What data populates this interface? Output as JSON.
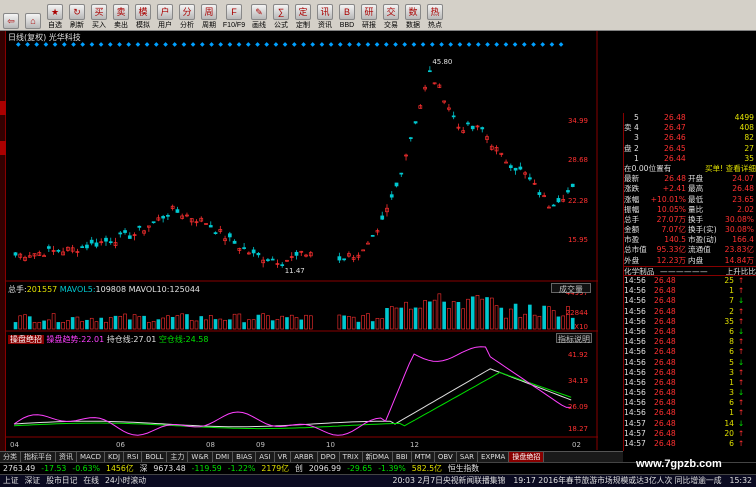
{
  "toolbar": {
    "buttons": [
      {
        "name": "back",
        "label": ""
      },
      {
        "name": "home",
        "label": ""
      },
      {
        "name": "zixuan",
        "label": "自选"
      },
      {
        "name": "shuaxin",
        "label": "刷新"
      },
      {
        "name": "maipai",
        "label": "买入"
      },
      {
        "name": "maichu",
        "label": "卖出"
      },
      {
        "name": "moni",
        "label": "模拟"
      },
      {
        "name": "yonghu",
        "label": "用户"
      },
      {
        "name": "fenshi",
        "label": "分析"
      },
      {
        "name": "tuopu",
        "label": "周期"
      },
      {
        "name": "f10",
        "label": "F10/F9"
      },
      {
        "name": "huaxian",
        "label": "画线"
      },
      {
        "name": "gongshi",
        "label": "公式"
      },
      {
        "name": "fangzhuang",
        "label": "定制"
      },
      {
        "name": "zixun",
        "label": "资讯"
      },
      {
        "name": "bbd",
        "label": "BBD"
      },
      {
        "name": "yanbao",
        "label": "研报"
      },
      {
        "name": "jiaoyi",
        "label": "交易"
      },
      {
        "name": "shuju",
        "label": "数据"
      },
      {
        "name": "redian",
        "label": "热点"
      }
    ]
  },
  "chart_header": {
    "title": "日线(复权)",
    "stock": "光华科技"
  },
  "price_axis": [
    "34.99",
    "28.68",
    "22.28",
    "15.95"
  ],
  "price_high_label": "45.80",
  "price_low_label": "11.47",
  "volume_header": {
    "label": "总手:",
    "total": "201557",
    "mavol5_label": "MAVOL5:",
    "mavol5": "109808",
    "mavol10_label": "MAVOL10:",
    "mavol10": "125044"
  },
  "volume_dropdown": "成交量",
  "volume_axis": [
    "44997",
    "22844",
    "X10"
  ],
  "indicator_header": {
    "name": "操盘绝招",
    "label1": "操盘趋势:",
    "value1": "22.01",
    "label2": "持仓线:",
    "value2": "27.01",
    "label3": "空仓线:",
    "value3": "24.58"
  },
  "indicator_button": "指标说明",
  "indicator_axis": [
    "41.92",
    "34.19",
    "26.09",
    "18.27"
  ],
  "date_axis": [
    "04",
    "06",
    "08",
    "09",
    "10",
    "12",
    "02"
  ],
  "panel": {
    "sell_label": "卖",
    "buy_label": "盘",
    "asks": [
      {
        "level": "5",
        "price": "26.48",
        "vol": "4499"
      },
      {
        "level": "4",
        "price": "26.47",
        "vol": "408"
      },
      {
        "level": "3",
        "price": "26.46",
        "vol": "82"
      },
      {
        "level": "2",
        "price": "26.45",
        "vol": "27"
      },
      {
        "level": "1",
        "price": "26.44",
        "vol": "35"
      }
    ],
    "mid_left": "在0.00位置有",
    "mid_right": "买单! 查看详细",
    "stats": [
      {
        "l1": "最新",
        "v1": "26.48",
        "l2": "开盘",
        "v2": "24.07"
      },
      {
        "l1": "涨跌",
        "v1": "+2.41",
        "l2": "最高",
        "v2": "26.48"
      },
      {
        "l1": "涨幅",
        "v1": "+10.01%",
        "l2": "最低",
        "v2": "23.65"
      },
      {
        "l1": "振幅",
        "v1": "10.05%",
        "l2": "量比",
        "v2": "2.02"
      },
      {
        "l1": "总手",
        "v1": "27.07万",
        "l2": "换手",
        "v2": "30.08%"
      },
      {
        "l1": "金额",
        "v1": "7.07亿",
        "l2": "换手(实)",
        "v2": "30.08%"
      },
      {
        "l1": "市盈",
        "v1": "140.5",
        "l2": "市盈(动)",
        "v2": "166.4"
      },
      {
        "l1": "总市值",
        "v1": "95.33亿",
        "l2": "流通值",
        "v2": "23.83亿"
      },
      {
        "l1": "外盘",
        "v1": "12.23万",
        "l2": "内盘",
        "v2": "14.84万"
      }
    ],
    "sub_tabs": [
      "化学制品",
      "—",
      "—",
      "—",
      "—",
      "—",
      "—",
      "上升比比"
    ],
    "ticks": [
      {
        "t": "14:56",
        "p": "26.48",
        "v": "25"
      },
      {
        "t": "14:56",
        "p": "26.48",
        "v": "1"
      },
      {
        "t": "14:56",
        "p": "26.48",
        "v": "7"
      },
      {
        "t": "14:56",
        "p": "26.48",
        "v": "2"
      },
      {
        "t": "14:56",
        "p": "26.48",
        "v": "35"
      },
      {
        "t": "14:56",
        "p": "26.48",
        "v": "6"
      },
      {
        "t": "14:56",
        "p": "26.48",
        "v": "8"
      },
      {
        "t": "14:56",
        "p": "26.48",
        "v": "6"
      },
      {
        "t": "14:56",
        "p": "26.48",
        "v": "5"
      },
      {
        "t": "14:56",
        "p": "26.48",
        "v": "3"
      },
      {
        "t": "14:56",
        "p": "26.48",
        "v": "1"
      },
      {
        "t": "14:56",
        "p": "26.48",
        "v": "3"
      },
      {
        "t": "14:56",
        "p": "26.48",
        "v": "6"
      },
      {
        "t": "14:56",
        "p": "26.48",
        "v": "1"
      },
      {
        "t": "14:57",
        "p": "26.48",
        "v": "14"
      },
      {
        "t": "14:57",
        "p": "26.48",
        "v": "20"
      },
      {
        "t": "14:57",
        "p": "26.48",
        "v": "6"
      }
    ]
  },
  "tabs": [
    "分类",
    "指标平台",
    "资讯",
    "MACD",
    "KDJ",
    "RSI",
    "BOLL",
    "主力",
    "W&R",
    "DMI",
    "BIAS",
    "ASI",
    "VR",
    "ARBR",
    "DPO",
    "TRIX",
    "新DMA",
    "BBI",
    "MTM",
    "OBV",
    "SAR",
    "EXPMA",
    "操盘绝招"
  ],
  "status": {
    "i1": "2763.49",
    "c1": "-17.53",
    "p1": "-0.63%",
    "a1": "1456亿",
    "n1": "深",
    "i2": "9673.48",
    "c2": "-119.59",
    "p2": "-1.22%",
    "a2": "2179亿",
    "n2": "创",
    "i3": "2096.99",
    "c3": "-29.65",
    "p3": "-1.39%",
    "a3": "582.5亿",
    "n3": "恒生指数"
  },
  "status2": {
    "items": [
      "上证",
      "深证",
      "股市日记",
      "在线",
      "24小时滚动"
    ],
    "news1": "20:03 2月7日央视新闻联播集锦",
    "news2": "19:17 2016年春节旅游市场规模或达3亿人次 同比增逾一成",
    "time": "15:32"
  },
  "watermark": "www.7gpzb.com",
  "colors": {
    "up": "#ff3030",
    "down": "#00c8d0",
    "ma_white": "#e0e0e0",
    "ma_yellow": "#e0e000",
    "indicator": "#ff40ff"
  }
}
